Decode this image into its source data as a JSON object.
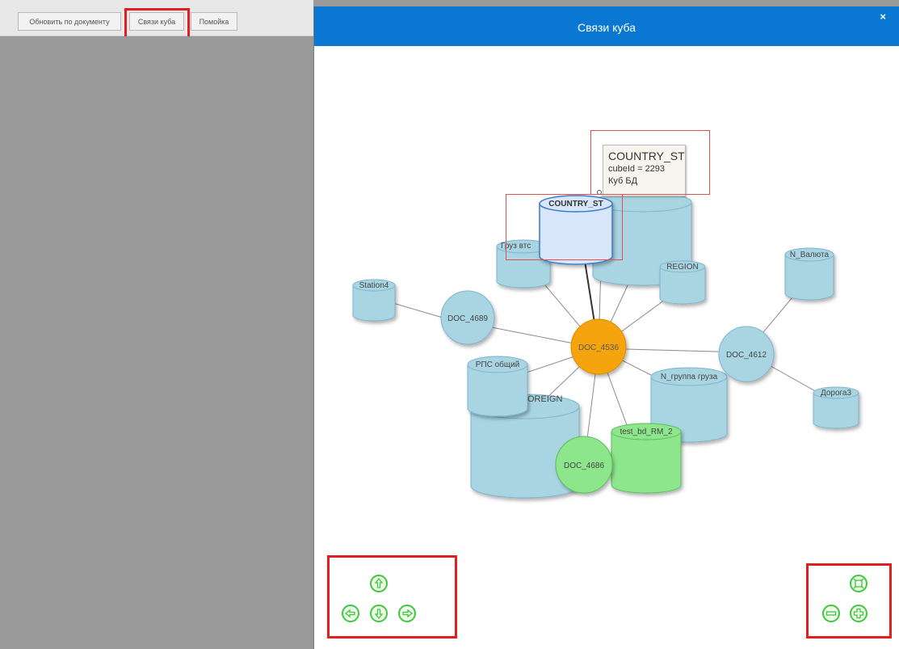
{
  "toolbar": {
    "refresh_label": "Обновить по документу",
    "links_label": "Связи куба",
    "help_label": "Помойка"
  },
  "dialog": {
    "title": "Связи куба",
    "close_label": "×"
  },
  "tooltip": {
    "title": "COUNTRY_ST",
    "cube_id": "cubeId = 2293",
    "type": "Куб БД"
  },
  "graph": {
    "center_node": "DOC_4536",
    "nodes": {
      "country": "COUNTRY_ST",
      "gruz": "Груз втс",
      "region": "REGION",
      "valuta": "N_Валюта",
      "station": "Station4",
      "doc4689": "DOC_4689",
      "doc4612": "DOC_4612",
      "rps": "РПС общий",
      "foreign": "OREIGN",
      "ngruppa": "N_группа груза",
      "doroga": "Дорога3",
      "testbd": "test_bd_RM_2",
      "doc4686": "DOC_4686"
    }
  },
  "colors": {
    "header": "#0a78d2",
    "center_node": "#f5a40a",
    "cylinder": "#a9d5e3",
    "selected": "#d7e6fb",
    "green_node": "#8de68b",
    "highlight": "#e02020"
  },
  "icons": {
    "pan_up": "arrow-up-icon",
    "pan_down": "arrow-down-icon",
    "pan_left": "arrow-left-icon",
    "pan_right": "arrow-right-icon",
    "zoom_extent": "zoom-extent-icon",
    "zoom_out": "zoom-out-icon",
    "zoom_in": "zoom-in-icon"
  }
}
